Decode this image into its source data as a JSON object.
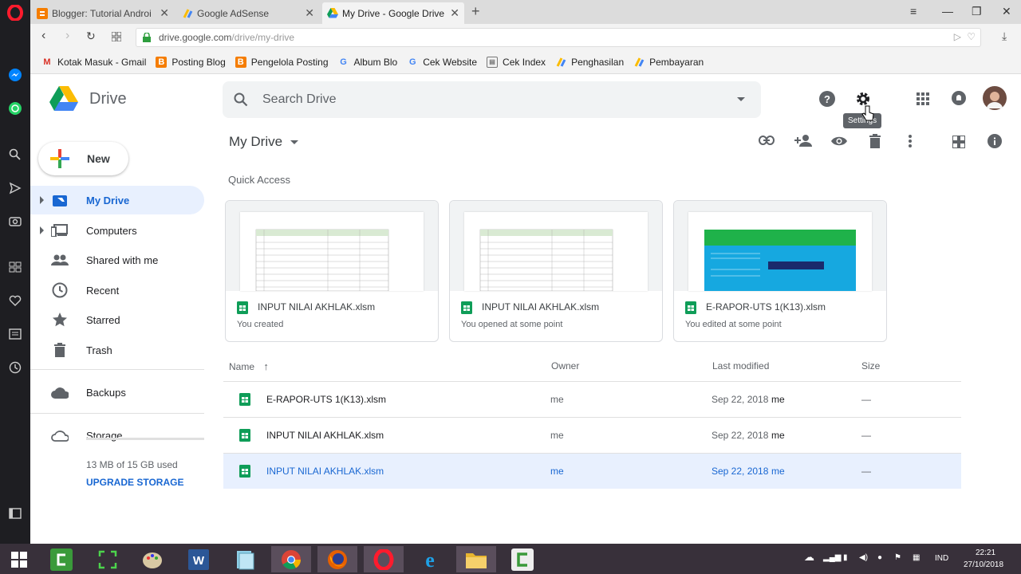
{
  "tabs": [
    {
      "label": "Blogger: Tutorial Android"
    },
    {
      "label": "Google AdSense"
    },
    {
      "label": "My Drive - Google Drive"
    }
  ],
  "url": {
    "host": "drive.google.com",
    "path": "/drive/my-drive"
  },
  "bookmarks": [
    {
      "label": "Kotak Masuk - Gmail",
      "icon": "gmail-icon"
    },
    {
      "label": "Posting Blog",
      "icon": "blogger-icon"
    },
    {
      "label": "Pengelola Posting",
      "icon": "blogger-icon"
    },
    {
      "label": "Album Blo",
      "icon": "google-icon"
    },
    {
      "label": "Cek Website",
      "icon": "google-icon"
    },
    {
      "label": "Cek Index",
      "icon": "search-console-icon"
    },
    {
      "label": "Penghasilan",
      "icon": "adsense-icon"
    },
    {
      "label": "Pembayaran",
      "icon": "adsense-icon"
    }
  ],
  "app": {
    "name": "Drive"
  },
  "search": {
    "placeholder": "Search Drive"
  },
  "tooltip": "Settings",
  "new_button": "New",
  "nav": [
    {
      "label": "My Drive"
    },
    {
      "label": "Computers"
    },
    {
      "label": "Shared with me"
    },
    {
      "label": "Recent"
    },
    {
      "label": "Starred"
    },
    {
      "label": "Trash"
    },
    {
      "label": "Backups"
    },
    {
      "label": "Storage"
    }
  ],
  "storage": {
    "used": "13 MB of 15 GB used",
    "upgrade": "UPGRADE STORAGE"
  },
  "breadcrumb": "My Drive",
  "quick_access": {
    "title": "Quick Access",
    "cards": [
      {
        "name": "INPUT NILAI AKHLAK.xlsm",
        "sub": "You created"
      },
      {
        "name": "INPUT NILAI AKHLAK.xlsm",
        "sub": "You opened at some point"
      },
      {
        "name": "E-RAPOR-UTS 1(K13).xlsm",
        "sub": "You edited at some point"
      }
    ]
  },
  "columns": {
    "name": "Name",
    "owner": "Owner",
    "modified": "Last modified",
    "size": "Size"
  },
  "files": [
    {
      "name": "E-RAPOR-UTS 1(K13).xlsm",
      "owner": "me",
      "date": "Sep 22, 2018",
      "by": "me",
      "size": "—"
    },
    {
      "name": "INPUT NILAI AKHLAK.xlsm",
      "owner": "me",
      "date": "Sep 22, 2018",
      "by": "me",
      "size": "—"
    },
    {
      "name": "INPUT NILAI AKHLAK.xlsm",
      "owner": "me",
      "date": "Sep 22, 2018",
      "by": "me",
      "size": "—"
    }
  ],
  "taskbar": {
    "lang": "IND",
    "time": "22:21",
    "date": "27/10/2018"
  },
  "colors": {
    "accent": "#1967d2",
    "selected_bg": "#e8f0fe",
    "sheets_green": "#0f9d58"
  }
}
